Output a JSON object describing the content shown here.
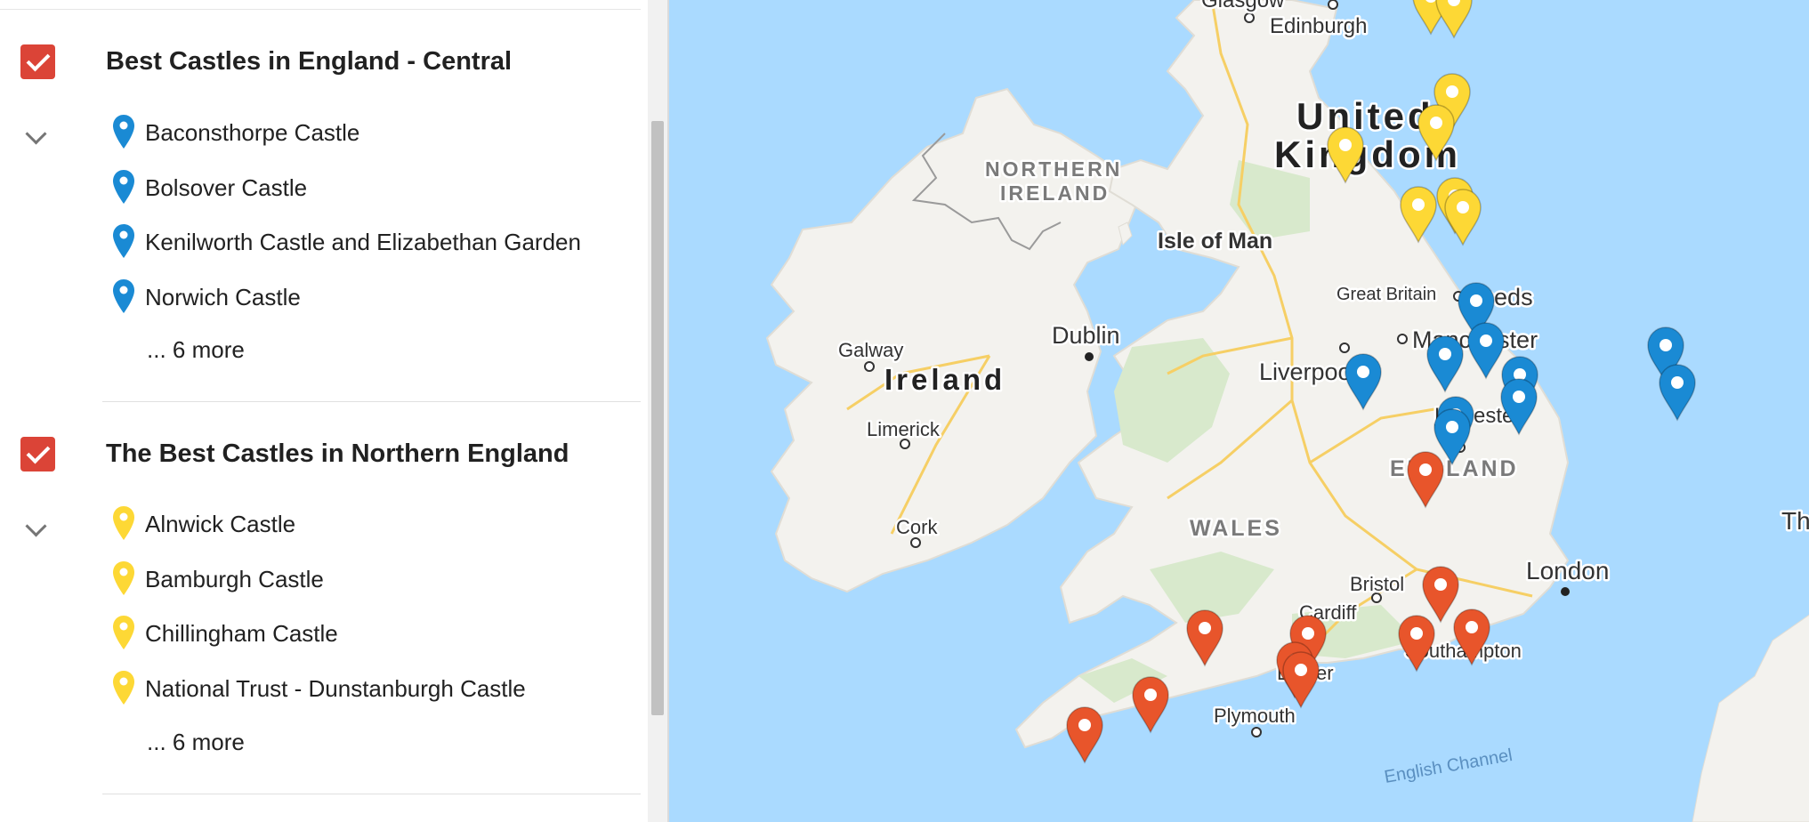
{
  "layers": [
    {
      "title": "Best Castles in England - Central",
      "color": "#1a8ad4",
      "checked": true,
      "places": [
        "Baconsthorpe Castle",
        "Bolsover Castle",
        "Kenilworth Castle and Elizabethan Garden",
        "Norwich Castle"
      ],
      "more": "... 6 more"
    },
    {
      "title": "The Best Castles in Northern England",
      "color": "#fdd835",
      "checked": true,
      "places": [
        "Alnwick Castle",
        "Bamburgh Castle",
        "Chillingham Castle",
        "National Trust - Dunstanburgh Castle"
      ],
      "more": "... 6 more"
    }
  ],
  "map": {
    "labels": {
      "glasgow": "Glasgow",
      "edinburgh": "Edinburgh",
      "united": "United",
      "kingdom": "Kingdom",
      "northern": "NORTHERN",
      "ireland_region": "IRELAND",
      "isle_of_man": "Isle of Man",
      "great_britain": "Great Britain",
      "leeds": "Leeds",
      "manchester": "Manchester",
      "liverpool": "Liverpool",
      "galway": "Galway",
      "dublin": "Dublin",
      "ireland": "Ireland",
      "limerick": "Limerick",
      "leicester": "Leicester",
      "england": "ENGLAND",
      "cork": "Cork",
      "wales": "WALES",
      "bristol": "Bristol",
      "cardiff": "Cardiff",
      "london": "London",
      "southampton": "Southampton",
      "exeter": "Exeter",
      "plymouth": "Plymouth",
      "english_channel": "English Channel",
      "the": "Th"
    },
    "marker_colors": {
      "central": "#1a8ad4",
      "northern": "#fdd835",
      "southern": "#e8552b"
    }
  }
}
